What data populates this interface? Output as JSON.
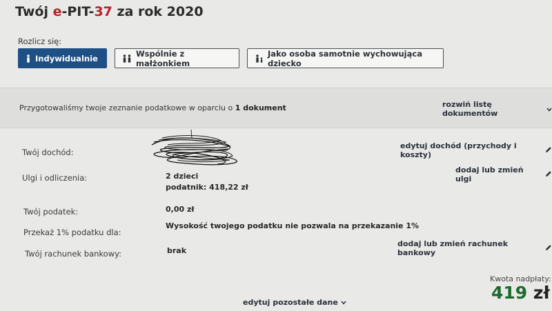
{
  "header": {
    "title_prefix": "Twój ",
    "title_accent_1": "e",
    "title_mid": "-PIT-",
    "title_accent_2": "37",
    "title_suffix": " za rok 2020"
  },
  "settlement": {
    "label": "Rozlicz się:",
    "options": [
      {
        "label": "Indywidualnie",
        "icon": "person-icon",
        "selected": true
      },
      {
        "label": "Wspólnie z małżonkiem",
        "icon": "couple-icon",
        "selected": false
      },
      {
        "label": "Jako osoba samotnie wychowująca dziecko",
        "icon": "parent-child-icon",
        "selected": false
      }
    ]
  },
  "summary": {
    "prepared_text": "Przygotowaliśmy twoje zeznanie podatkowe w oparciu o ",
    "prepared_bold": "1 dokument",
    "expand_link": "rozwiń listę dokumentów"
  },
  "rows": {
    "income": {
      "label": "Twój dochód:",
      "link": "edytuj dochód (przychody i koszty)"
    },
    "reliefs": {
      "label": "Ulgi i odliczenia:",
      "value_line1": "2 dzieci",
      "value_line2": "podatnik: 418,22 zł",
      "link": "dodaj lub zmień ulgi"
    },
    "tax": {
      "label": "Twój podatek:",
      "value": "0,00 zł"
    },
    "donation": {
      "label": "Przekaż 1% podatku dla:",
      "value": "Wysokość twojego podatku nie pozwala na przekazanie 1%"
    },
    "bank": {
      "label": "Twój rachunek bankowy:",
      "value": "brak",
      "link": "dodaj lub zmień rachunek bankowy"
    }
  },
  "refund": {
    "label": "Kwota nadpłaty:",
    "amount": "419",
    "currency": "zł"
  },
  "footer": {
    "edit_other": "edytuj pozostałe dane"
  },
  "colors": {
    "primary": "#1e4f85",
    "accent": "#b5212c",
    "refund": "#1d6a2f"
  }
}
